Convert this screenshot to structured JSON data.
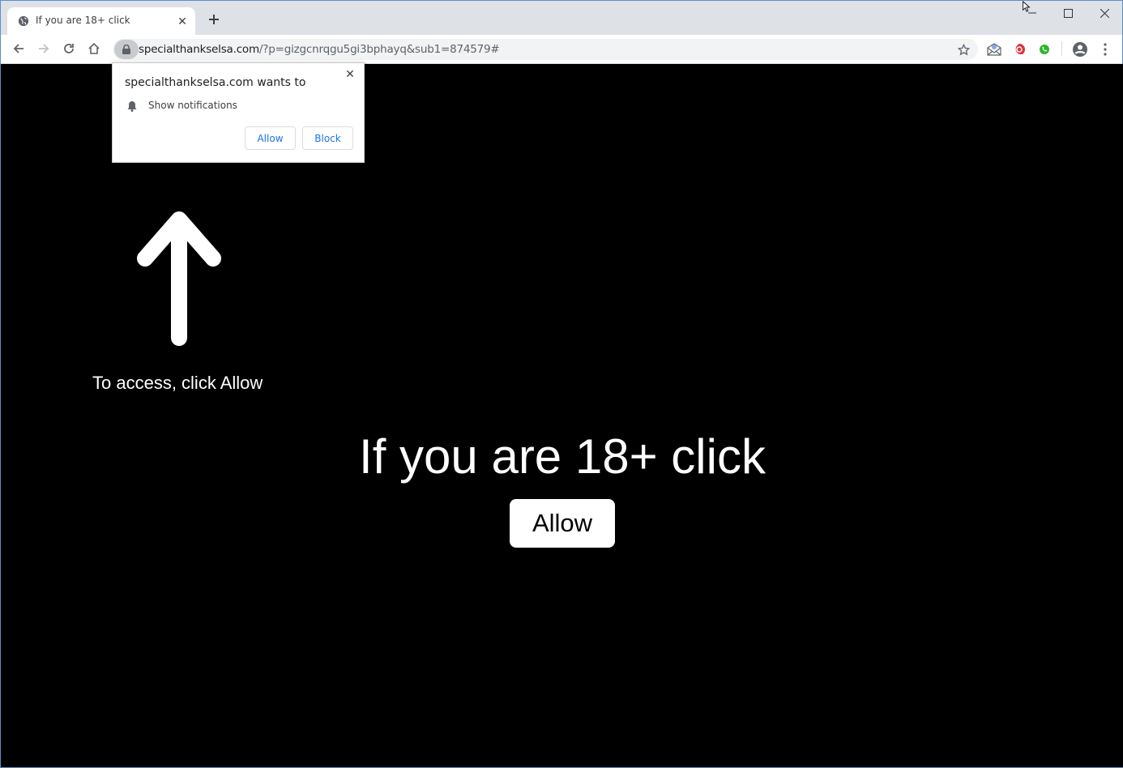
{
  "browser": {
    "tab": {
      "title": "If you are 18+ click",
      "favicon": "globe-icon"
    },
    "new_tab_icon": "plus-icon",
    "window_controls": [
      "minimize-icon",
      "maximize-icon",
      "close-icon"
    ],
    "nav": [
      "back-icon",
      "forward-icon",
      "reload-icon",
      "home-icon"
    ],
    "url": {
      "host": "specialthankselsa.com",
      "path": "/?p=gizgcnrqgu5gi3bphayq&sub1=874579#"
    },
    "extensions": [
      "mail-extension-icon",
      "red-extension-icon",
      "green-phone-extension-icon"
    ],
    "profile_icon": "account-icon",
    "menu_icon": "kebab-menu-icon"
  },
  "permission_popup": {
    "title": "specialthankselsa.com wants to",
    "permission": "Show notifications",
    "allow_label": "Allow",
    "block_label": "Block"
  },
  "page": {
    "arrow_hint": "To access, click Allow",
    "headline": "If you are 18+ click",
    "allow_button": "Allow"
  },
  "colors": {
    "page_background": "#000000",
    "text": "#ffffff",
    "popup_button_text": "#1a73e8",
    "tabstrip": "#dee1e6"
  }
}
